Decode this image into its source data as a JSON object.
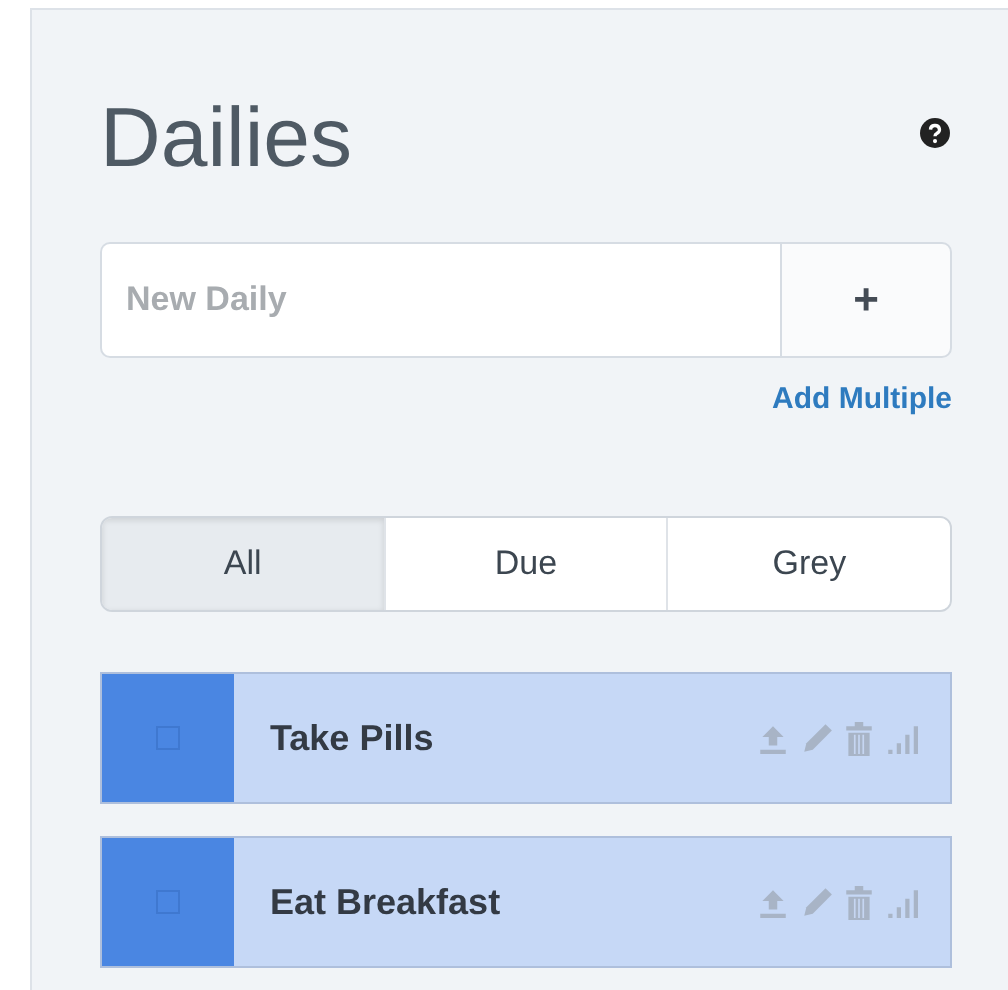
{
  "title": "Dailies",
  "new_daily": {
    "placeholder": "New Daily",
    "button": "+"
  },
  "add_multiple": "Add Multiple",
  "tabs": [
    {
      "label": "All",
      "selected": true
    },
    {
      "label": "Due",
      "selected": false
    },
    {
      "label": "Grey",
      "selected": false
    }
  ],
  "dailies": [
    {
      "name": "Take Pills",
      "checked": false
    },
    {
      "name": "Eat Breakfast",
      "checked": false
    }
  ]
}
